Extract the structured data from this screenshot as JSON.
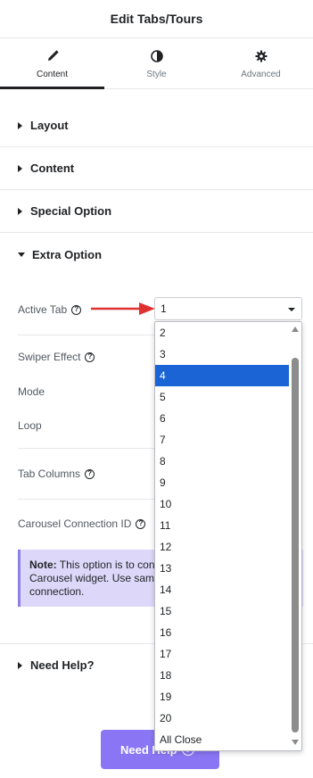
{
  "header": {
    "title": "Edit Tabs/Tours"
  },
  "tabs": [
    {
      "label": "Content",
      "icon": "pencil-icon",
      "active": true
    },
    {
      "label": "Style",
      "icon": "contrast-icon",
      "active": false
    },
    {
      "label": "Advanced",
      "icon": "gear-icon",
      "active": false
    }
  ],
  "sections": {
    "layout": "Layout",
    "content": "Content",
    "special_option": "Special Option",
    "extra_option": "Extra Option"
  },
  "controls": {
    "active_tab": {
      "label": "Active Tab",
      "value": "1"
    },
    "swiper_effect": {
      "label": "Swiper Effect"
    },
    "mode": {
      "label": "Mode"
    },
    "loop": {
      "label": "Loop"
    },
    "tab_columns": {
      "label": "Tab Columns"
    },
    "carousel_connection_id": {
      "label": "Carousel Connection ID"
    }
  },
  "note": {
    "bold": "Note:",
    "line1": " This option is to con",
    "line2": "Carousel widget. Use sam",
    "line3": "connection."
  },
  "need_help": {
    "section_title": "Need Help?",
    "button_label": "Need Help"
  },
  "dropdown": {
    "options": [
      "2",
      "3",
      "4",
      "5",
      "6",
      "7",
      "8",
      "9",
      "10",
      "11",
      "12",
      "13",
      "14",
      "15",
      "16",
      "17",
      "18",
      "19",
      "20",
      "All Close"
    ],
    "selected": "4"
  },
  "colors": {
    "accent": "#8a76f5",
    "selection": "#1a64d6",
    "note_bg": "#ddd8fa",
    "arrow": "#e03131"
  }
}
